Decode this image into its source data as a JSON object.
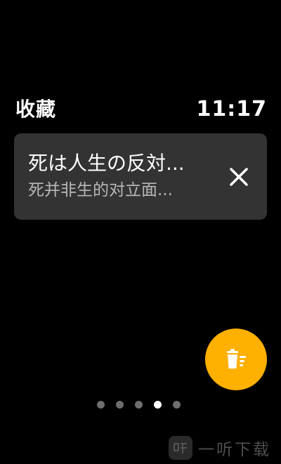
{
  "header": {
    "title": "收藏",
    "time": "11:17"
  },
  "favorites": [
    {
      "primary": "死は人生の反対...",
      "secondary": "死并非生的对立面..."
    }
  ],
  "icons": {
    "remove": "close-icon",
    "fab": "clear-all-icon"
  },
  "pager": {
    "count": 5,
    "active_index": 3
  },
  "colors": {
    "background": "#000000",
    "card": "#333333",
    "accent": "#ffb000",
    "secondary_text": "#b8b8b8"
  },
  "watermark": {
    "text": "一听下载"
  }
}
